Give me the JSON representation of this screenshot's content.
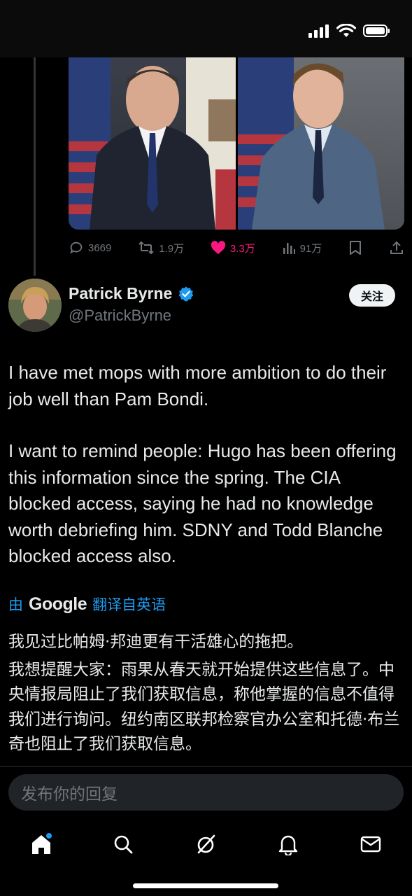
{
  "status_bar": {
    "signal": "signal-icon",
    "wifi": "wifi-icon",
    "battery": "battery-icon"
  },
  "previous_tweet": {
    "replies": "3669",
    "retweets": "1.9万",
    "likes": "3.3万",
    "views": "91万",
    "colors": {
      "like": "#f91880",
      "muted": "#71767b"
    }
  },
  "tweet": {
    "author_name": "Patrick Byrne",
    "author_handle": "@PatrickByrne",
    "follow_label": "关注",
    "verified_color": "#1d9bf0",
    "paragraphs": [
      "I have met mops with more ambition to do their job well than Pam Bondi.",
      "I want to remind people: Hugo has been offering this information since the spring. The CIA blocked access, saying he had no knowledge worth debriefing him. SDNY and Todd Blanche blocked access also."
    ],
    "translation": {
      "prefix": "由",
      "brand": "Google",
      "suffix": "翻译自英语",
      "paragraphs": [
        "我见过比帕姆·邦迪更有干活雄心的拖把。",
        "我想提醒大家：雨果从春天就开始提供这些信息了。中央情报局阻止了我们获取信息，称他掌握的信息不值得我们进行询问。纽约南区联邦检察官办公室和托德·布兰奇也阻止了我们获取信息。"
      ]
    }
  },
  "reply": {
    "placeholder": "发布你的回复"
  },
  "tab_bar": {
    "tabs": [
      "home-icon",
      "search-icon",
      "grok-icon",
      "notifications-icon",
      "messages-icon"
    ],
    "accent": "#1d9bf0"
  }
}
